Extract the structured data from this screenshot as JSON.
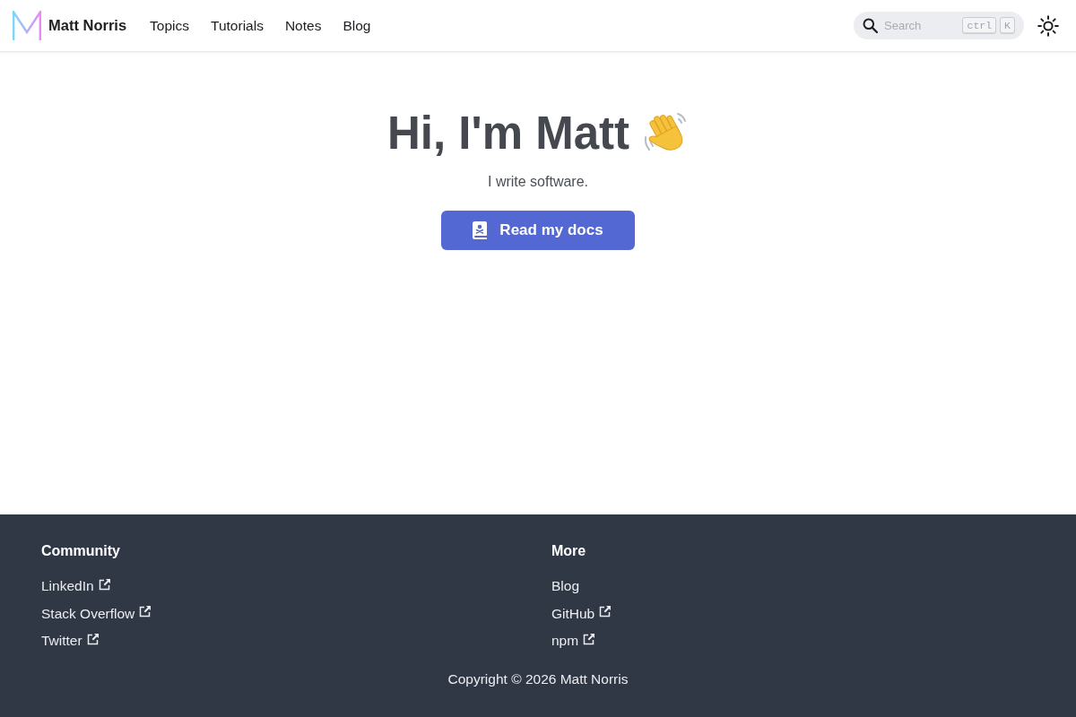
{
  "navbar": {
    "brand": "Matt Norris",
    "links": [
      "Topics",
      "Tutorials",
      "Notes",
      "Blog"
    ],
    "search": {
      "placeholder": "Search",
      "keys": [
        "ctrl",
        "K"
      ]
    }
  },
  "hero": {
    "title": "Hi, I'm Matt",
    "subtitle": "I write software.",
    "button": "Read my docs"
  },
  "footer": {
    "columns": [
      {
        "title": "Community",
        "links": [
          {
            "label": "LinkedIn",
            "external": true
          },
          {
            "label": "Stack Overflow",
            "external": true
          },
          {
            "label": "Twitter",
            "external": true
          }
        ]
      },
      {
        "title": "More",
        "links": [
          {
            "label": "Blog",
            "external": false
          },
          {
            "label": "GitHub",
            "external": true
          },
          {
            "label": "npm",
            "external": true
          }
        ]
      }
    ],
    "copyright": "Copyright © 2026 Matt Norris"
  }
}
